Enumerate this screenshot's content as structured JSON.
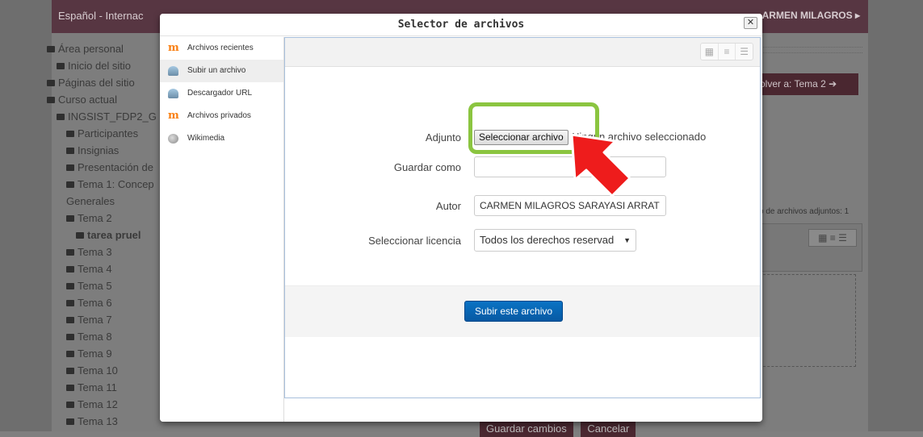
{
  "background": {
    "language": "Español - Internac",
    "user": "ARMEN MILAGROS ▸",
    "nav": [
      {
        "label": "Área personal",
        "indent": 0
      },
      {
        "label": "Inicio del sitio",
        "indent": 1
      },
      {
        "label": "Páginas del sitio",
        "indent": 0
      },
      {
        "label": "Curso actual",
        "indent": 0
      },
      {
        "label": "INGSIST_FDP2_G",
        "indent": 1
      },
      {
        "label": "Participantes",
        "indent": 2
      },
      {
        "label": "Insignias",
        "indent": 2
      },
      {
        "label": "Presentación de",
        "indent": 2
      },
      {
        "label": "Tema 1: Concep",
        "indent": 2
      },
      {
        "label": "Generales",
        "indent": 2
      },
      {
        "label": "Tema 2",
        "indent": 2
      },
      {
        "label": "tarea pruel",
        "indent": 3
      },
      {
        "label": "Tema 3",
        "indent": 2
      },
      {
        "label": "Tema 4",
        "indent": 2
      },
      {
        "label": "Tema 5",
        "indent": 2
      },
      {
        "label": "Tema 6",
        "indent": 2
      },
      {
        "label": "Tema 7",
        "indent": 2
      },
      {
        "label": "Tema 8",
        "indent": 2
      },
      {
        "label": "Tema 9",
        "indent": 2
      },
      {
        "label": "Tema 10",
        "indent": 2
      },
      {
        "label": "Tema 11",
        "indent": 2
      },
      {
        "label": "Tema 12",
        "indent": 2
      },
      {
        "label": "Tema 13",
        "indent": 2
      }
    ],
    "back_button": "olver a: Tema 2 ➔",
    "attachments_label": "o de archivos adjuntos: 1",
    "save_button": "Guardar cambios",
    "cancel_button": "Cancelar"
  },
  "dialog": {
    "title": "Selector de archivos",
    "close": "✕",
    "repositories": [
      {
        "label": "Archivos recientes",
        "icon": "moodle-icon"
      },
      {
        "label": "Subir un archivo",
        "icon": "upload-icon"
      },
      {
        "label": "Descargador URL",
        "icon": "url-icon"
      },
      {
        "label": "Archivos privados",
        "icon": "moodle-icon"
      },
      {
        "label": "Wikimedia",
        "icon": "wikimedia-icon"
      }
    ],
    "view_icons": [
      "▦",
      "≡",
      "☰"
    ],
    "form": {
      "attachment_label": "Adjunto",
      "choose_file": "Seleccionar archivo",
      "file_status": "Ningún archivo seleccionado",
      "save_as_label": "Guardar como",
      "save_as_value": "",
      "author_label": "Autor",
      "author_value": "CARMEN MILAGROS SARAYASI ARRAT",
      "license_label": "Seleccionar licencia",
      "license_value": "Todos los derechos reservad"
    },
    "submit": "Subir este archivo"
  },
  "colors": {
    "accent_green": "#8bc540",
    "arrow_red": "#ee1c1c",
    "primary_blue": "#0a6fc2"
  }
}
